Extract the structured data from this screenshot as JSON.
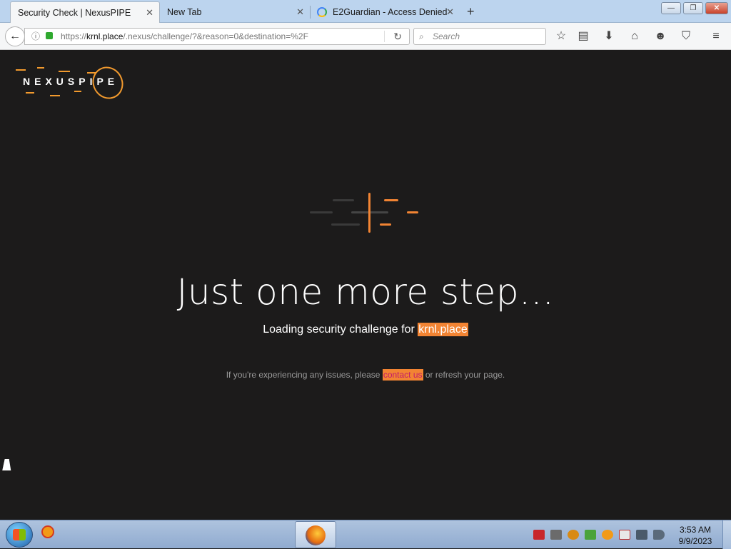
{
  "browser": {
    "tabs": [
      {
        "label": "Security Check | NexusPIPE",
        "close": "✕"
      },
      {
        "label": "New Tab",
        "close": "✕"
      },
      {
        "label": "E2Guardian - Access Denied",
        "close": "✕"
      }
    ],
    "new_tab": "+",
    "window_controls": {
      "minimize": "—",
      "maximize": "❐",
      "close": "✕"
    },
    "url": {
      "prefix": "https://",
      "domain": "krnl.place",
      "path": "/.nexus/challenge/?&reason=0&destination=%2F"
    },
    "search_placeholder": "Search",
    "icons": [
      "back-icon",
      "info-icon",
      "lock-icon",
      "reload-icon",
      "search-icon",
      "bookmark-star-icon",
      "reading-list-icon",
      "download-icon",
      "home-icon",
      "hello-icon",
      "pocket-icon",
      "menu-icon"
    ]
  },
  "page": {
    "logo_text": "NEXUSPIPE",
    "headline": "Just one more step...",
    "subline_prefix": "Loading security challenge for",
    "subline_domain": "krnl.place",
    "issues_prefix": "If you're experiencing any issues, please",
    "issues_link": "contact us",
    "issues_suffix": "or refresh your page.",
    "accent_color": "#f28433",
    "background_color": "#1c1b1b"
  },
  "taskbar": {
    "time": "3:53 AM",
    "date": "9/9/2023"
  }
}
